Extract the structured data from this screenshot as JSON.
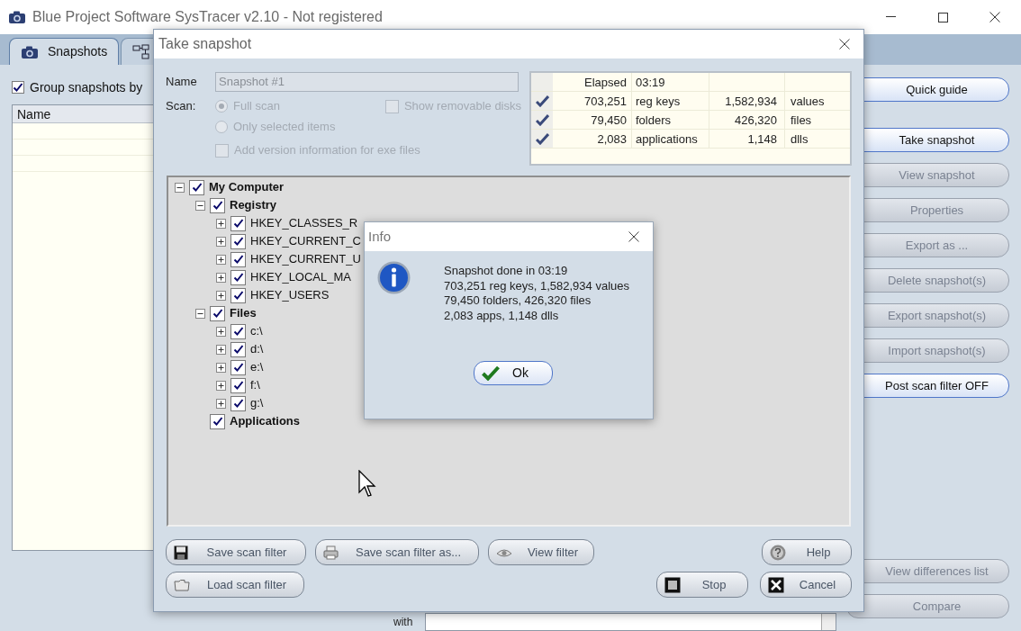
{
  "window": {
    "title": "Blue Project Software SysTracer v2.10 - Not registered"
  },
  "tabs": [
    {
      "label": "Snapshots",
      "selected": true
    },
    {
      "selected": false
    }
  ],
  "group_checkbox": {
    "label": "Group snapshots by",
    "checked": true
  },
  "snapshot_list": {
    "columns": [
      "Name"
    ]
  },
  "side_buttons": [
    {
      "label": "Quick guide",
      "disabled": false
    },
    {
      "label": "Take snapshot",
      "disabled": false
    },
    {
      "label": "View snapshot",
      "disabled": true
    },
    {
      "label": "Properties",
      "disabled": true
    },
    {
      "label": "Export as ...",
      "disabled": true
    },
    {
      "label": "Delete snapshot(s)",
      "disabled": true
    },
    {
      "label": "Export snapshot(s)",
      "disabled": true
    },
    {
      "label": "Import snapshot(s)",
      "disabled": true
    },
    {
      "label": "Post scan filter OFF",
      "disabled": false
    }
  ],
  "compare_buttons": [
    {
      "label": "View differences list",
      "disabled": true
    },
    {
      "label": "Compare",
      "disabled": true
    }
  ],
  "compare_with": {
    "label": "with"
  },
  "snapshot_dialog": {
    "title": "Take snapshot",
    "name_label": "Name",
    "name_value": "Snapshot #1",
    "scan_label": "Scan:",
    "scan_options": [
      {
        "label": "Full scan",
        "selected": true
      },
      {
        "label": "Only selected items",
        "selected": false
      }
    ],
    "show_removable": {
      "label": "Show removable disks",
      "checked": false
    },
    "add_version": {
      "label": "Add version information for exe files",
      "checked": false
    },
    "elapsed": {
      "label": "Elapsed",
      "value": "03:19"
    },
    "stats": [
      {
        "checked": true,
        "count": "703,251",
        "label": "reg keys",
        "count2": "1,582,934",
        "label2": "values"
      },
      {
        "checked": true,
        "count": "79,450",
        "label": "folders",
        "count2": "426,320",
        "label2": "files"
      },
      {
        "checked": true,
        "count": "2,083",
        "label": "applications",
        "count2": "1,148",
        "label2": "dlls"
      }
    ],
    "tree": [
      {
        "label": "My Computer",
        "expanded": true,
        "checked": true,
        "children": [
          {
            "label": "Registry",
            "expanded": true,
            "checked": true,
            "children": [
              {
                "label": "HKEY_CLASSES_R",
                "expanded": false,
                "checked": true
              },
              {
                "label": "HKEY_CURRENT_C",
                "expanded": false,
                "checked": true
              },
              {
                "label": "HKEY_CURRENT_U",
                "expanded": false,
                "checked": true
              },
              {
                "label": "HKEY_LOCAL_MA",
                "expanded": false,
                "checked": true
              },
              {
                "label": "HKEY_USERS",
                "expanded": false,
                "checked": true
              }
            ]
          },
          {
            "label": "Files",
            "expanded": true,
            "checked": true,
            "children": [
              {
                "label": "c:\\",
                "expanded": false,
                "checked": true
              },
              {
                "label": "d:\\",
                "expanded": false,
                "checked": true
              },
              {
                "label": "e:\\",
                "expanded": false,
                "checked": true
              },
              {
                "label": "f:\\",
                "expanded": false,
                "checked": true
              },
              {
                "label": "g:\\",
                "expanded": false,
                "checked": true
              }
            ]
          },
          {
            "label": "Applications",
            "checked": true
          }
        ]
      }
    ],
    "left_buttons": [
      [
        {
          "label": "Save scan filter",
          "kind": "save"
        },
        {
          "label": "Save scan filter as...",
          "kind": "print"
        },
        {
          "label": "View filter",
          "kind": "view"
        }
      ],
      [
        {
          "label": "Load scan filter",
          "kind": "load"
        }
      ]
    ],
    "right_buttons": [
      [
        {
          "label": "Help",
          "kind": "help"
        }
      ],
      [
        {
          "label": "Stop",
          "kind": "stop"
        },
        {
          "label": "Cancel",
          "kind": "cancel"
        }
      ]
    ]
  },
  "info_dialog": {
    "title": "Info",
    "lines": [
      "Snapshot done in 03:19",
      "703,251 reg keys, 1,582,934 values",
      "79,450 folders, 426,320 files",
      "2,083 apps, 1,148 dlls"
    ],
    "ok_label": "Ok"
  }
}
